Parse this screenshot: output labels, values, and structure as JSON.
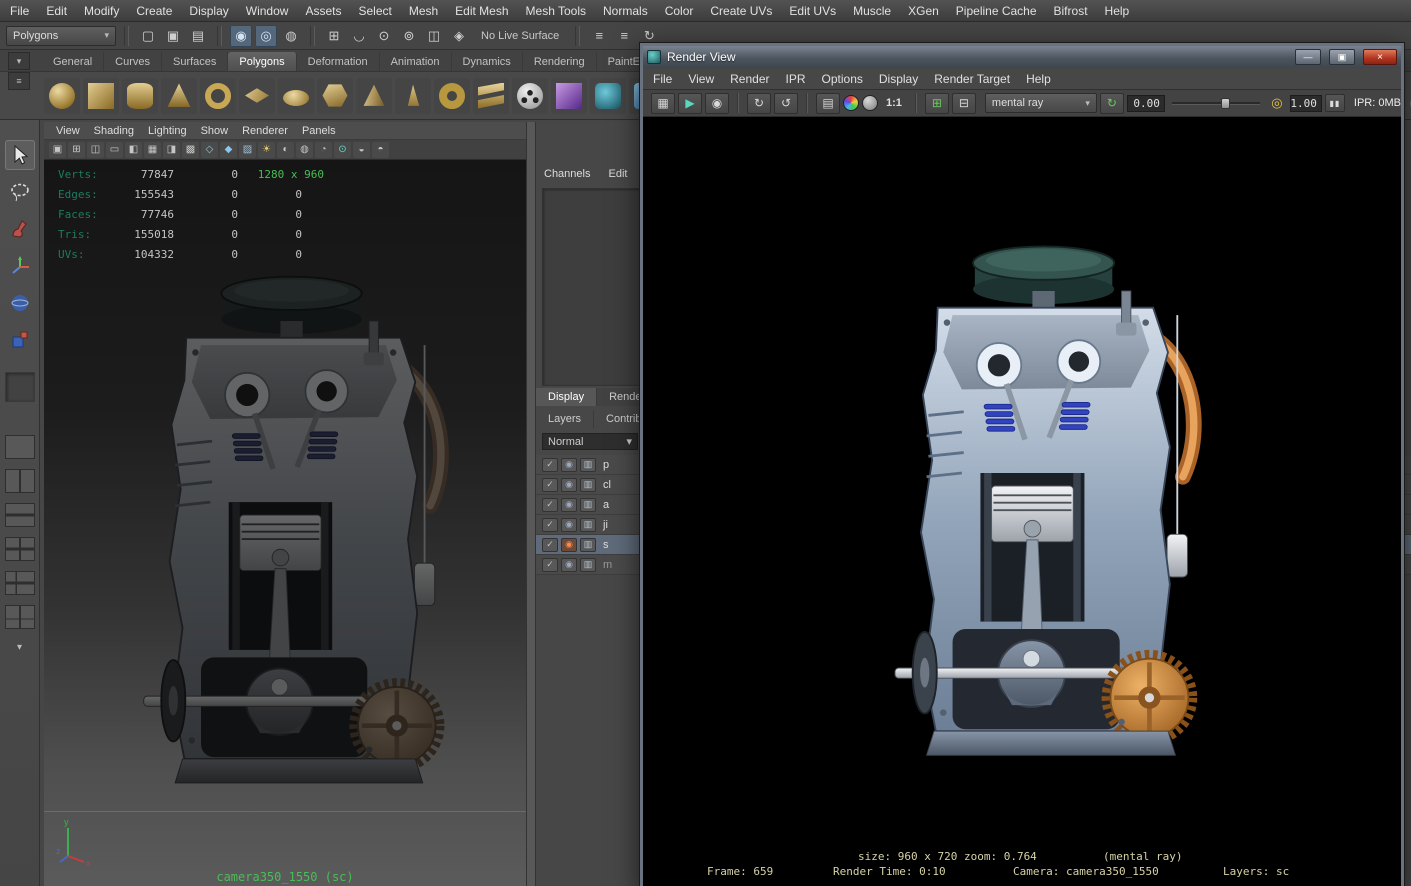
{
  "colors": {
    "hud_green": "#49bd57",
    "hud_label": "#1e7a5f",
    "status_text": "#d6d2a6",
    "accent_selected": "#5f6b7a",
    "close_red": "#b03420",
    "spring_blue": "#3243c0",
    "copper": "#c98038"
  },
  "glyphs": {
    "down_arrow": "▾",
    "pause": "▮▮",
    "window_min": "—",
    "window_max": "▣",
    "window_close": "×",
    "refresh": "↻"
  },
  "menubar": {
    "items": [
      "File",
      "Edit",
      "Modify",
      "Create",
      "Display",
      "Window",
      "Assets",
      "Select",
      "Mesh",
      "Edit Mesh",
      "Mesh Tools",
      "Normals",
      "Color",
      "Create UVs",
      "Edit UVs",
      "Muscle",
      "XGen",
      "Pipeline Cache",
      "Bifrost",
      "Help"
    ]
  },
  "statusline": {
    "mode": "Polygons",
    "live_surface": "No Live Surface"
  },
  "statusline_icons": [
    {
      "name": "new-scene-icon",
      "g": "▢"
    },
    {
      "name": "open-scene-icon",
      "g": "▣"
    },
    {
      "name": "save-scene-icon",
      "g": "▤"
    },
    {
      "name": "select-hierarchy-icon",
      "g": "◉"
    },
    {
      "name": "select-object-icon",
      "g": "◎"
    },
    {
      "name": "select-component-icon",
      "g": "◍"
    },
    {
      "name": "snap-grid-icon",
      "g": "⊞"
    },
    {
      "name": "snap-curve-icon",
      "g": "◡"
    },
    {
      "name": "snap-point-icon",
      "g": "⊙"
    },
    {
      "name": "snap-projected-center-icon",
      "g": "⊚"
    },
    {
      "name": "snap-view-plane-icon",
      "g": "◫"
    },
    {
      "name": "make-live-icon",
      "g": "◈"
    },
    {
      "name": "input-connections-icon",
      "g": "≡"
    },
    {
      "name": "output-connections-icon",
      "g": "≡"
    },
    {
      "name": "construction-history-icon",
      "g": "↻"
    }
  ],
  "shelf_widget": [
    {
      "name": "shelf-menu-icon",
      "g": "▾"
    },
    {
      "name": "shelf-tabs-icon",
      "g": "≡"
    }
  ],
  "shelf": {
    "tabs": [
      "General",
      "Curves",
      "Surfaces",
      "Polygons",
      "Deformation",
      "Animation",
      "Dynamics",
      "Rendering",
      "PaintEffe"
    ],
    "active": "Polygons"
  },
  "viewport": {
    "menu": [
      "View",
      "Shading",
      "Lighting",
      "Show",
      "Renderer",
      "Panels"
    ],
    "hud": {
      "rows": [
        {
          "label": "Verts:",
          "total": "77847",
          "sel": "0",
          "res": "1280 x 960"
        },
        {
          "label": "Edges:",
          "total": "155543",
          "sel": "0",
          "col3": "0"
        },
        {
          "label": "Faces:",
          "total": "77746",
          "sel": "0",
          "col3": "0"
        },
        {
          "label": "Tris:",
          "total": "155018",
          "sel": "0",
          "col3": "0"
        },
        {
          "label": "UVs:",
          "total": "104332",
          "sel": "0",
          "col3": "0"
        }
      ]
    },
    "camera_label": "camera350_1550 (sc)",
    "axis": {
      "x": "x",
      "y": "y",
      "z": "z"
    }
  },
  "viewport_toolbar_icons": [
    {
      "name": "lock-camera-icon",
      "g": "▣"
    },
    {
      "name": "grid-icon",
      "g": "⊞"
    },
    {
      "name": "film-gate-icon",
      "g": "◫"
    },
    {
      "name": "resolution-gate-icon",
      "g": "▭"
    },
    {
      "name": "gate-mask-icon",
      "g": "◧"
    },
    {
      "name": "field-chart-icon",
      "g": "▦"
    },
    {
      "name": "safe-action-icon",
      "g": "◨"
    },
    {
      "name": "safe-title-icon",
      "g": "▩"
    },
    {
      "name": "wireframe-icon",
      "g": "◇"
    },
    {
      "name": "shaded-icon",
      "g": "◆"
    },
    {
      "name": "textured-icon",
      "g": "▨"
    },
    {
      "name": "use-all-lights-icon",
      "g": "☀"
    },
    {
      "name": "shadows-icon",
      "g": "◐"
    },
    {
      "name": "screen-space-ao-icon",
      "g": "◍"
    },
    {
      "name": "motion-blur-icon",
      "g": "◔"
    },
    {
      "name": "multisampling-icon",
      "g": "⊙"
    },
    {
      "name": "xray-icon",
      "g": "◒"
    },
    {
      "name": "isolate-select-icon",
      "g": "◓"
    }
  ],
  "channel_box": {
    "tabs": [
      "Channels",
      "Edit"
    ],
    "editor_tabs": [
      "Display",
      "Rende"
    ],
    "section_tabs": [
      "Layers",
      "Contribut"
    ],
    "blend_mode": "Normal",
    "layers": [
      "p",
      "cl",
      "a",
      "ji",
      "s",
      "m"
    ],
    "selected_layer": "s"
  },
  "layer_row_icons": [
    {
      "name": "layer-visibility-icon",
      "g": "✓"
    },
    {
      "name": "layer-renderable-icon",
      "g": "◉"
    },
    {
      "name": "layer-swatch-icon",
      "g": "▥"
    }
  ],
  "render_view": {
    "title": "Render View",
    "menu": [
      "File",
      "View",
      "Render",
      "IPR",
      "Options",
      "Display",
      "Render Target",
      "Help"
    ],
    "toolbar": {
      "renderer": "mental ray",
      "ratio": "1:1",
      "exposure": "0.00",
      "gamma": "1.00",
      "ipr_memory": "IPR: 0MB"
    },
    "status": {
      "size_zoom": "size: 960 x 720 zoom: 0.764",
      "renderer_note": "(mental ray)",
      "frame": "Frame: 659",
      "render_time": "Render Time: 0:10",
      "camera": "Camera: camera350_1550",
      "layers": "Layers: sc"
    }
  },
  "render_toolbar_icons": [
    {
      "name": "render-current-frame-icon",
      "g": "▦"
    },
    {
      "name": "ipr-render-icon",
      "g": "▶"
    },
    {
      "name": "snapshot-icon",
      "g": "◉"
    },
    {
      "name": "redo-previous-render-icon",
      "g": "↻"
    },
    {
      "name": "refresh-ipr-icon",
      "g": "↺"
    },
    {
      "name": "render-settings-icon",
      "g": "▤"
    },
    {
      "name": "keep-image-icon",
      "g": "⊞"
    },
    {
      "name": "remove-image-icon",
      "g": "⊟"
    }
  ]
}
